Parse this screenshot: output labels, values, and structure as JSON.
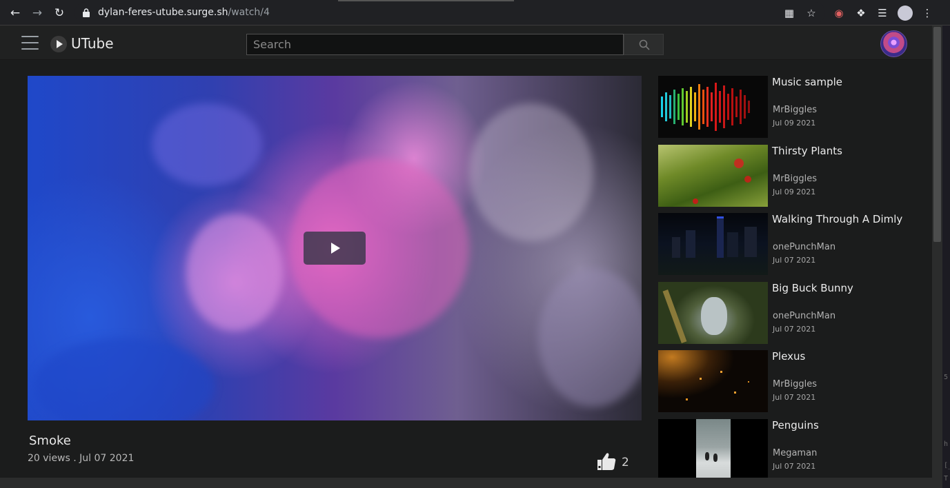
{
  "browser": {
    "url_host": "dylan-feres-utube.surge.sh",
    "url_path": "/watch/4"
  },
  "header": {
    "logo_text": "UTube",
    "search_placeholder": "Search"
  },
  "video": {
    "title": "Smoke",
    "meta": "20 views . Jul 07 2021",
    "likes": "2"
  },
  "sidebar": {
    "items": [
      {
        "title": "Music sample",
        "channel": "MrBiggles",
        "date": "Jul 09 2021"
      },
      {
        "title": "Thirsty Plants",
        "channel": "MrBiggles",
        "date": "Jul 09 2021"
      },
      {
        "title": "Walking Through A Dimly",
        "channel": "onePunchMan",
        "date": "Jul 07 2021"
      },
      {
        "title": "Big Buck Bunny",
        "channel": "onePunchMan",
        "date": "Jul 07 2021"
      },
      {
        "title": "Plexus",
        "channel": "MrBiggles",
        "date": "Jul 07 2021"
      },
      {
        "title": "Penguins",
        "channel": "Megaman",
        "date": "Jul 07 2021"
      }
    ]
  },
  "right_strip_chars": [
    "5",
    "h",
    "[_",
    "T"
  ]
}
